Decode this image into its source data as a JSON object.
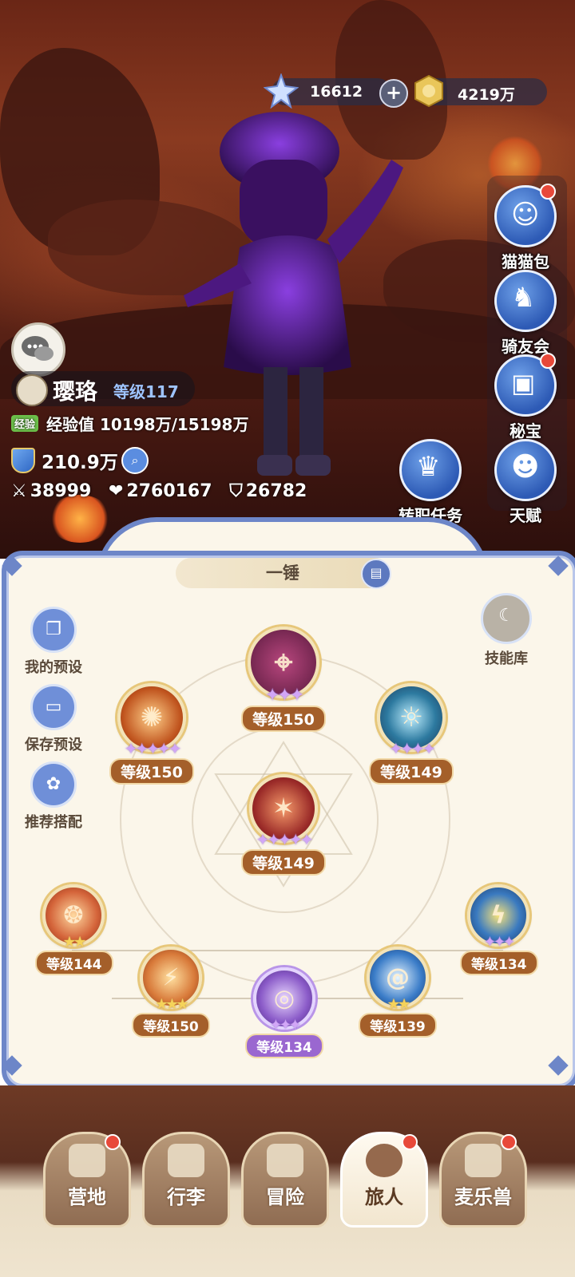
{
  "currencies": {
    "stars": "16612",
    "gold": "4219万"
  },
  "side_menu": [
    {
      "label": "猫猫包",
      "icon": "cat-bag-icon",
      "badge": true
    },
    {
      "label": "骑友会",
      "icon": "horse-icon",
      "badge": false
    },
    {
      "label": "秘宝",
      "icon": "treasure-icon",
      "badge": true
    },
    {
      "label": "天赋",
      "icon": "brain-icon",
      "badge": false
    }
  ],
  "job_change": {
    "label": "转职任务"
  },
  "player": {
    "name": "璎珞",
    "level": "等级117",
    "exp_tag": "经验",
    "exp_label": "经验值",
    "exp_value": "10198万/15198万",
    "power": "210.9万",
    "attack": "38999",
    "hp": "2760167",
    "defense": "26782"
  },
  "panel": {
    "loadout_name": "一锤",
    "left_buttons": [
      "我的预设",
      "保存预设",
      "推荐搭配"
    ],
    "skill_library": "技能库"
  },
  "skills": [
    {
      "level": "等级150",
      "stars": 3,
      "star_type": "purple"
    },
    {
      "level": "等级150",
      "stars": 5,
      "star_type": "purple"
    },
    {
      "level": "等级149",
      "stars": 4,
      "star_type": "purple"
    },
    {
      "level": "等级149",
      "stars": 5,
      "star_type": "purple"
    },
    {
      "level": "等级144",
      "stars": 2,
      "star_type": "gold"
    },
    {
      "level": "等级134",
      "stars": 3,
      "star_type": "purple"
    },
    {
      "level": "等级150",
      "stars": 3,
      "star_type": "gold"
    },
    {
      "level": "等级134",
      "stars": 3,
      "star_type": "purple",
      "badge_style": "purple"
    },
    {
      "level": "等级139",
      "stars": 2,
      "star_type": "gold"
    }
  ],
  "nav": [
    {
      "label": "营地",
      "badge": true,
      "active": false
    },
    {
      "label": "行李",
      "badge": false,
      "active": false
    },
    {
      "label": "冒险",
      "badge": false,
      "active": false
    },
    {
      "label": "旅人",
      "badge": true,
      "active": true
    },
    {
      "label": "麦乐兽",
      "badge": true,
      "active": false
    }
  ],
  "colors": {
    "accent": "#6d86c8",
    "level_badge": "#a45f2a",
    "notify": "#e8493a"
  }
}
